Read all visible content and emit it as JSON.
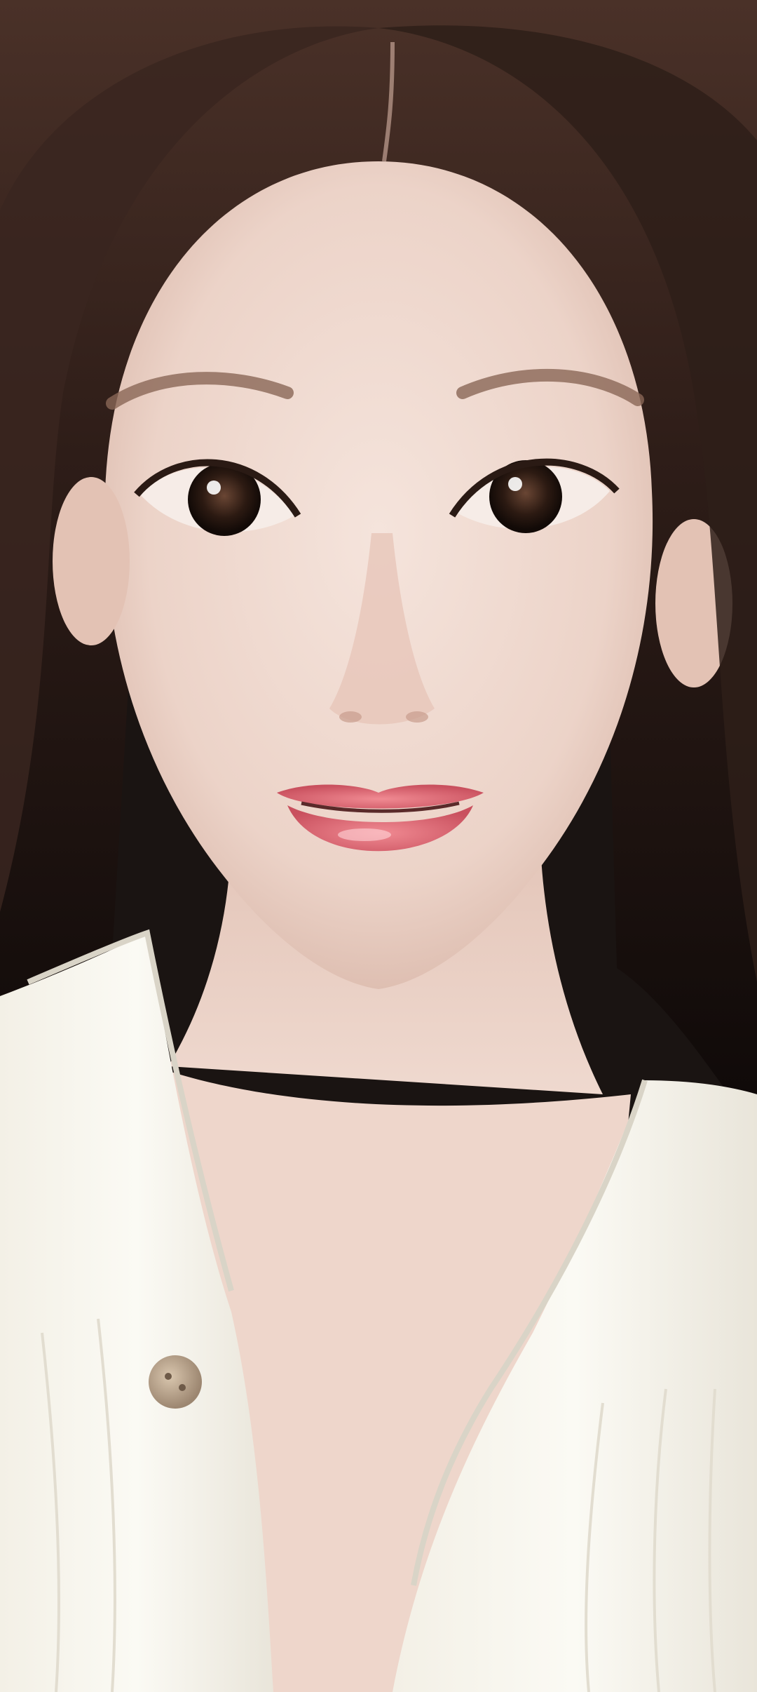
{
  "photo": {
    "subject": "selfie-portrait",
    "colors": {
      "hair": "#3a2620",
      "hair_dark": "#140e0c",
      "skin": "#efd9d0",
      "skin_shadow": "#dcbcb0",
      "lips": "#d9606c",
      "shirt": "#f6f3ea",
      "shirt_shadow": "#dcd8cc",
      "button": "#b9a48c",
      "eye": "#2a1a14",
      "background_top_right": "#e8e8e4"
    }
  }
}
